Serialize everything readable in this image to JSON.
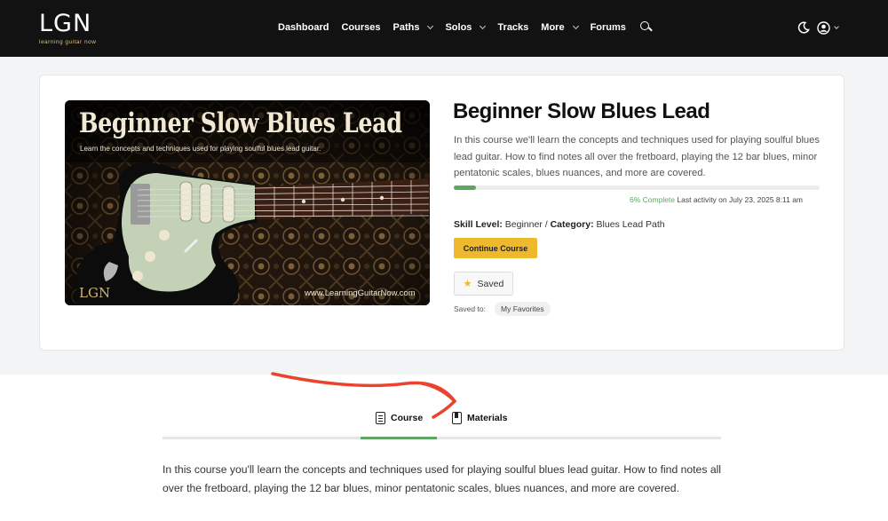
{
  "nav": {
    "logo_mark": "LGN",
    "logo_sub": "learning guitar now",
    "links": [
      {
        "label": "Dashboard",
        "dropdown": false
      },
      {
        "label": "Courses",
        "dropdown": false
      },
      {
        "label": "Paths",
        "dropdown": true
      },
      {
        "label": "Solos",
        "dropdown": true
      },
      {
        "label": "Tracks",
        "dropdown": false
      },
      {
        "label": "More",
        "dropdown": true
      },
      {
        "label": "Forums",
        "dropdown": false
      }
    ],
    "icons": [
      "search-icon",
      "moon-icon",
      "user-icon"
    ]
  },
  "course": {
    "thumbnail": {
      "title": "Beginner Slow Blues Lead",
      "subtitle": "Learn the concepts and techniques used for playing soulful blues lead guitar.",
      "url": "www.LearningGuitarNow.com",
      "logo": "LGN"
    },
    "title": "Beginner Slow Blues Lead",
    "description": "In this course we'll learn the concepts and techniques used for playing soulful blues lead guitar. How to find notes all over the fretboard, playing the 12 bar blues, minor pentatonic scales, blues nuances, and more are covered.",
    "progress": {
      "percent": 6,
      "complete_label": "6% Complete",
      "last_activity": "Last activity on July 23, 2025 8:11 am"
    },
    "skill_label": "Skill Level:",
    "skill_value": "Beginner",
    "separator": "/",
    "category_label": "Category:",
    "category_value": "Blues Lead Path",
    "continue_label": "Continue Course",
    "saved_label": "Saved",
    "saved_to_label": "Saved to:",
    "saved_to_value": "My Favorites"
  },
  "tabs": [
    {
      "label": "Course",
      "active": true,
      "icon": "document-icon"
    },
    {
      "label": "Materials",
      "active": false,
      "icon": "book-icon"
    }
  ],
  "body_text": "In this course you'll learn the concepts and techniques used for playing soulful blues lead guitar. How to find notes all over the fretboard, playing the 12 bar blues, minor pentatonic scales, blues nuances, and more are covered.",
  "colors": {
    "nav_bg": "#121212",
    "accent_green": "#5ea763",
    "button_yellow": "#efb92e",
    "annotation_arrow": "#e8442e"
  }
}
